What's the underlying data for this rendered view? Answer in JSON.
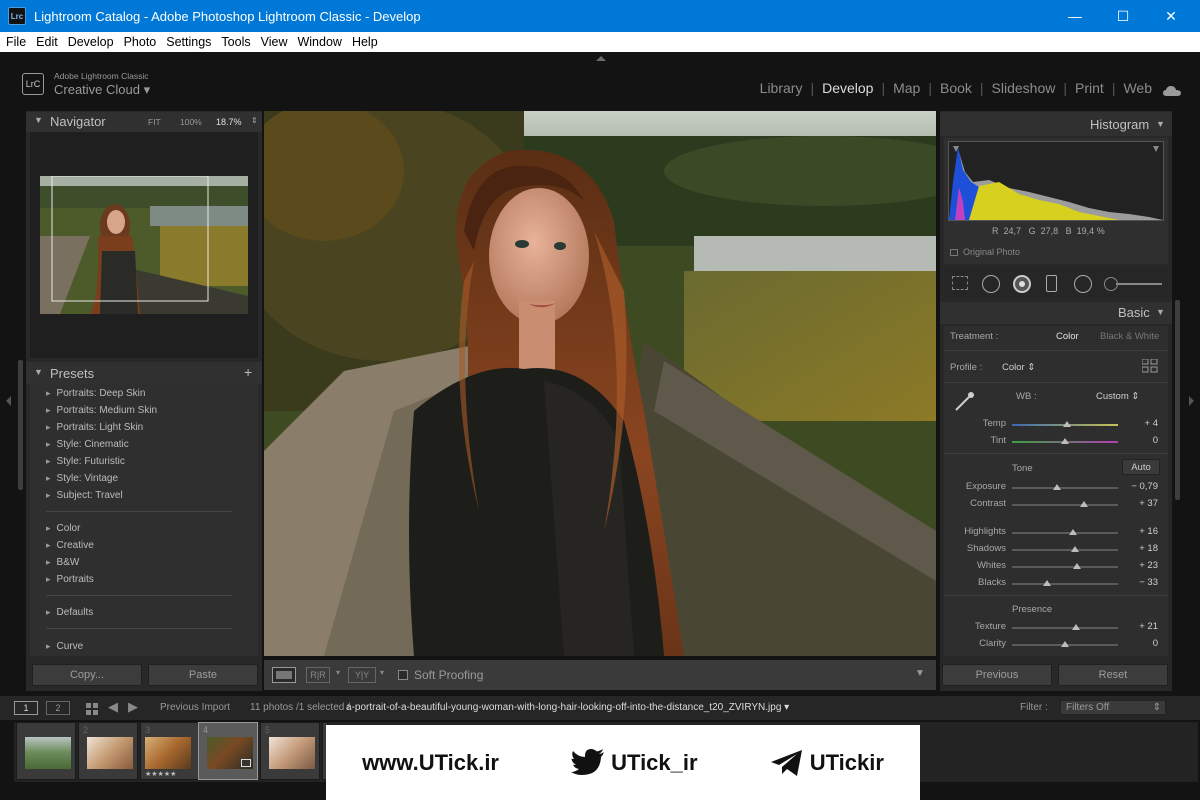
{
  "window": {
    "title": "Lightroom Catalog - Adobe Photoshop Lightroom Classic - Develop",
    "app_icon": "Lrc"
  },
  "menu": [
    "File",
    "Edit",
    "Develop",
    "Photo",
    "Settings",
    "Tools",
    "View",
    "Window",
    "Help"
  ],
  "identity": {
    "badge": "LrC",
    "line1": "Adobe Lightroom Classic",
    "line2": "Creative Cloud"
  },
  "modules": [
    "Library",
    "Develop",
    "Map",
    "Book",
    "Slideshow",
    "Print",
    "Web"
  ],
  "active_module": "Develop",
  "navigator": {
    "title": "Navigator",
    "fit": "FIT",
    "pct100": "100%",
    "zoom": "18.7%"
  },
  "presets": {
    "title": "Presets",
    "group1": [
      "Portraits: Deep Skin",
      "Portraits: Medium Skin",
      "Portraits: Light Skin",
      "Style: Cinematic",
      "Style: Futuristic",
      "Style: Vintage",
      "Subject: Travel"
    ],
    "group2": [
      "Color",
      "Creative",
      "B&W",
      "Portraits"
    ],
    "group3": [
      "Defaults"
    ],
    "group4": [
      "Curve"
    ]
  },
  "left_buttons": {
    "copy": "Copy...",
    "paste": "Paste"
  },
  "toolbar": {
    "soft_proofing": "Soft Proofing"
  },
  "histogram": {
    "title": "Histogram",
    "r_label": "R",
    "r": "24,7",
    "g_label": "G",
    "g": "27,8",
    "b_label": "B",
    "b": "19,4",
    "pct": "%",
    "original": "Original Photo"
  },
  "basic": {
    "title": "Basic",
    "treatment_label": "Treatment :",
    "treatment_color": "Color",
    "treatment_bw": "Black & White",
    "profile_label": "Profile :",
    "profile_value": "Color",
    "wb_label": "WB :",
    "wb_value": "Custom",
    "tone_label": "Tone",
    "auto": "Auto",
    "presence_label": "Presence",
    "sliders": [
      {
        "label": "Temp",
        "value": "+ 4",
        "pos": 0.52
      },
      {
        "label": "Tint",
        "value": "0",
        "pos": 0.5
      },
      {
        "label": "Exposure",
        "value": "− 0,79",
        "pos": 0.42
      },
      {
        "label": "Contrast",
        "value": "+ 37",
        "pos": 0.68
      },
      {
        "label": "Highlights",
        "value": "+ 16",
        "pos": 0.58
      },
      {
        "label": "Shadows",
        "value": "+ 18",
        "pos": 0.59
      },
      {
        "label": "Whites",
        "value": "+ 23",
        "pos": 0.61
      },
      {
        "label": "Blacks",
        "value": "− 33",
        "pos": 0.33
      },
      {
        "label": "Texture",
        "value": "+ 21",
        "pos": 0.6
      },
      {
        "label": "Clarity",
        "value": "0",
        "pos": 0.5
      }
    ]
  },
  "right_buttons": {
    "previous": "Previous",
    "reset": "Reset"
  },
  "filmstrip": {
    "page1": "1",
    "page2": "2",
    "source": "Previous Import",
    "count": "11 photos /1 selected /",
    "filename": "a-portrait-of-a-beautiful-young-woman-with-long-hair-looking-off-into-the-distance_t20_ZVIRYN.jpg",
    "filter_label": "Filter :",
    "filter_value": "Filters Off",
    "cell_numbers": [
      "",
      "2",
      "3",
      "4",
      "5"
    ],
    "stars": "★★★★★"
  },
  "watermark": {
    "site": "www.UTick.ir",
    "twitter": "UTick_ir",
    "telegram": "UTickir"
  }
}
